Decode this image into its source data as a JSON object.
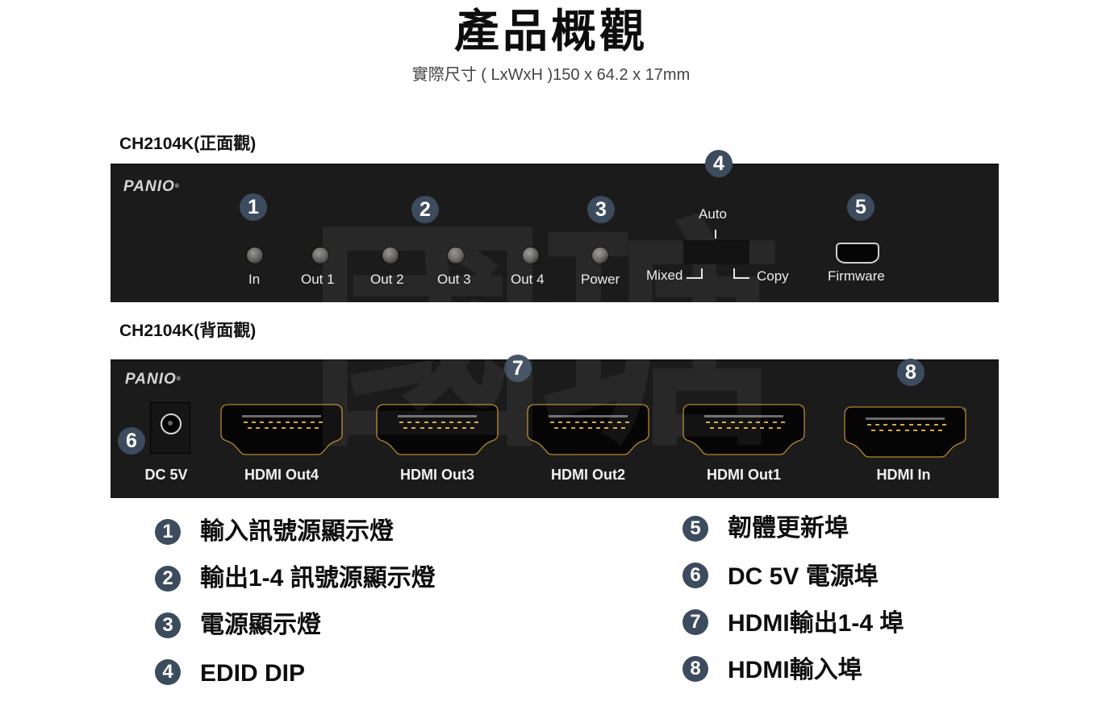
{
  "header": {
    "title": "產品概觀",
    "subtitle": "實際尺寸 ( LxWxH )150 x 64.2 x 17mm"
  },
  "front": {
    "label": "CH2104K(正面觀)",
    "brand": "PANIO",
    "badges": [
      "1",
      "2",
      "3",
      "4",
      "5"
    ],
    "leds": [
      "In",
      "Out 1",
      "Out 2",
      "Out 3",
      "Out 4",
      "Power"
    ],
    "dip": {
      "top": "Auto",
      "left": "Mixed",
      "right": "Copy"
    },
    "firmware_port": "Firmware"
  },
  "back": {
    "label": "CH2104K(背面觀)",
    "brand": "PANIO",
    "badges": {
      "dc": "6",
      "outputs": "7",
      "input": "8"
    },
    "ports": [
      "DC 5V",
      "HDMI Out4",
      "HDMI Out3",
      "HDMI Out2",
      "HDMI Out1",
      "HDMI In"
    ]
  },
  "watermark": "國瑭",
  "legend": [
    {
      "num": "1",
      "text": "輸入訊號源顯示燈"
    },
    {
      "num": "2",
      "text": "輸出1-4 訊號源顯示燈"
    },
    {
      "num": "3",
      "text": "電源顯示燈"
    },
    {
      "num": "4",
      "text": "EDID DIP"
    },
    {
      "num": "5",
      "text": "韌體更新埠"
    },
    {
      "num": "6",
      "text": "DC 5V 電源埠"
    },
    {
      "num": "7",
      "text": "HDMI輸出1-4 埠"
    },
    {
      "num": "8",
      "text": "HDMI輸入埠"
    }
  ],
  "colors": {
    "panel": "#1b1b1b",
    "badge": "#3d4b5e",
    "hdmi_outline": "#b8862e",
    "hdmi_pins": "#e0a53a"
  }
}
